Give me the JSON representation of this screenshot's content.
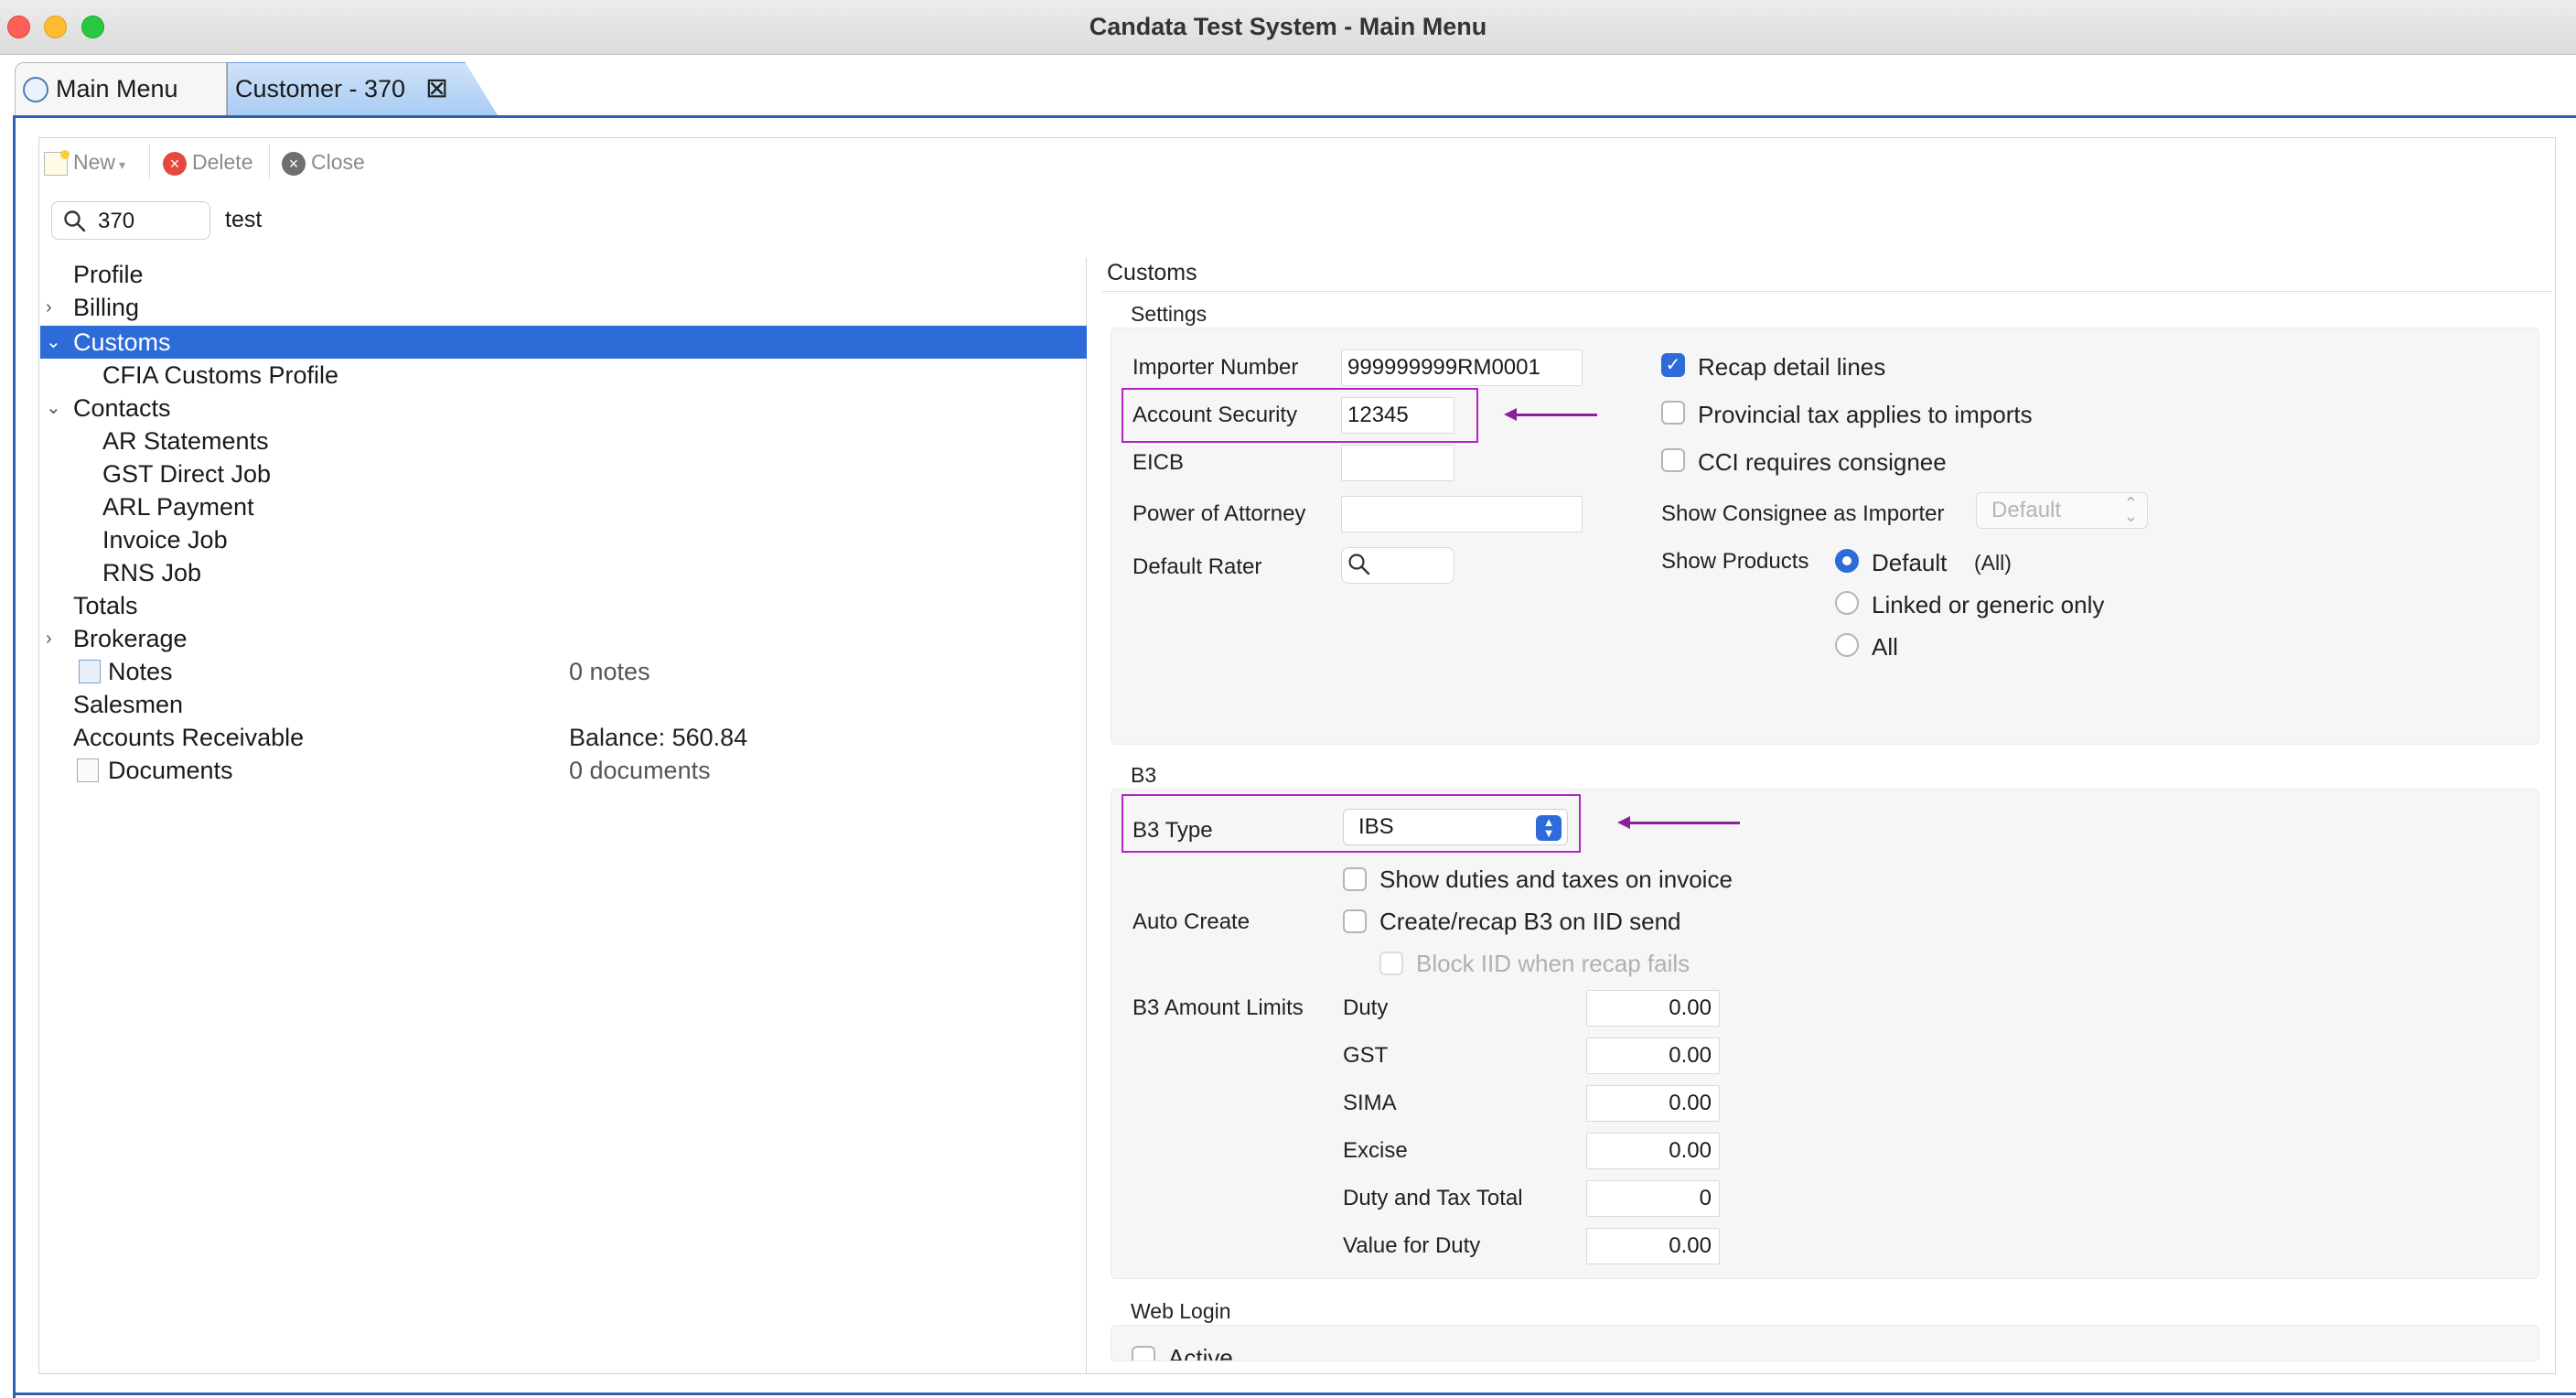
{
  "window": {
    "title": "Candata Test System - Main Menu"
  },
  "tabs": [
    {
      "label": "Main Menu"
    },
    {
      "label": "Customer - 370"
    }
  ],
  "toolbar": {
    "new_label": "New",
    "delete_label": "Delete",
    "close_label": "Close"
  },
  "search": {
    "value": "370",
    "label": "test"
  },
  "tree": {
    "profile": "Profile",
    "billing": "Billing",
    "customs": "Customs",
    "cfia": "CFIA Customs Profile",
    "contacts": "Contacts",
    "ar_statements": "AR Statements",
    "gst_direct_job": "GST Direct Job",
    "arl_payment": "ARL Payment",
    "invoice_job": "Invoice Job",
    "rns_job": "RNS Job",
    "totals": "Totals",
    "brokerage": "Brokerage",
    "notes": "Notes",
    "notes_count": "0 notes",
    "salesmen": "Salesmen",
    "ar": "Accounts Receivable",
    "ar_balance": "Balance: 560.84",
    "documents": "Documents",
    "documents_count": "0 documents"
  },
  "customs": {
    "title": "Customs",
    "settings_label": "Settings",
    "importer_number_label": "Importer Number",
    "importer_number": "999999999RM0001",
    "account_security_label": "Account Security",
    "account_security": "12345",
    "eicb_label": "EICB",
    "eicb": "",
    "poa_label": "Power of Attorney",
    "poa": "",
    "default_rater_label": "Default Rater",
    "recap_label": "Recap detail lines",
    "recap_checked": true,
    "provincial_label": "Provincial tax applies to imports",
    "cci_label": "CCI requires consignee",
    "show_consignee_label": "Show Consignee as Importer",
    "show_consignee_value": "Default",
    "show_products_label": "Show Products",
    "sp_default": "Default",
    "sp_default_note": "(All)",
    "sp_linked": "Linked or generic only",
    "sp_all": "All"
  },
  "b3": {
    "section_label": "B3",
    "type_label": "B3 Type",
    "type_value": "IBS",
    "show_duties_label": "Show duties and taxes on invoice",
    "auto_create_label": "Auto Create",
    "create_recap_label": "Create/recap B3 on IID send",
    "block_iid_label": "Block IID when recap fails",
    "limits_label": "B3 Amount Limits",
    "limits": [
      {
        "label": "Duty",
        "value": "0.00"
      },
      {
        "label": "GST",
        "value": "0.00"
      },
      {
        "label": "SIMA",
        "value": "0.00"
      },
      {
        "label": "Excise",
        "value": "0.00"
      },
      {
        "label": "Duty and Tax Total",
        "value": "0"
      },
      {
        "label": "Value for Duty",
        "value": "0.00"
      }
    ]
  },
  "web_login": {
    "section_label": "Web Login",
    "active_label": "Active"
  },
  "colors": {
    "accent": "#2d6bd8",
    "annotation": "#b224c4",
    "tab_border": "#2f5fb3"
  }
}
